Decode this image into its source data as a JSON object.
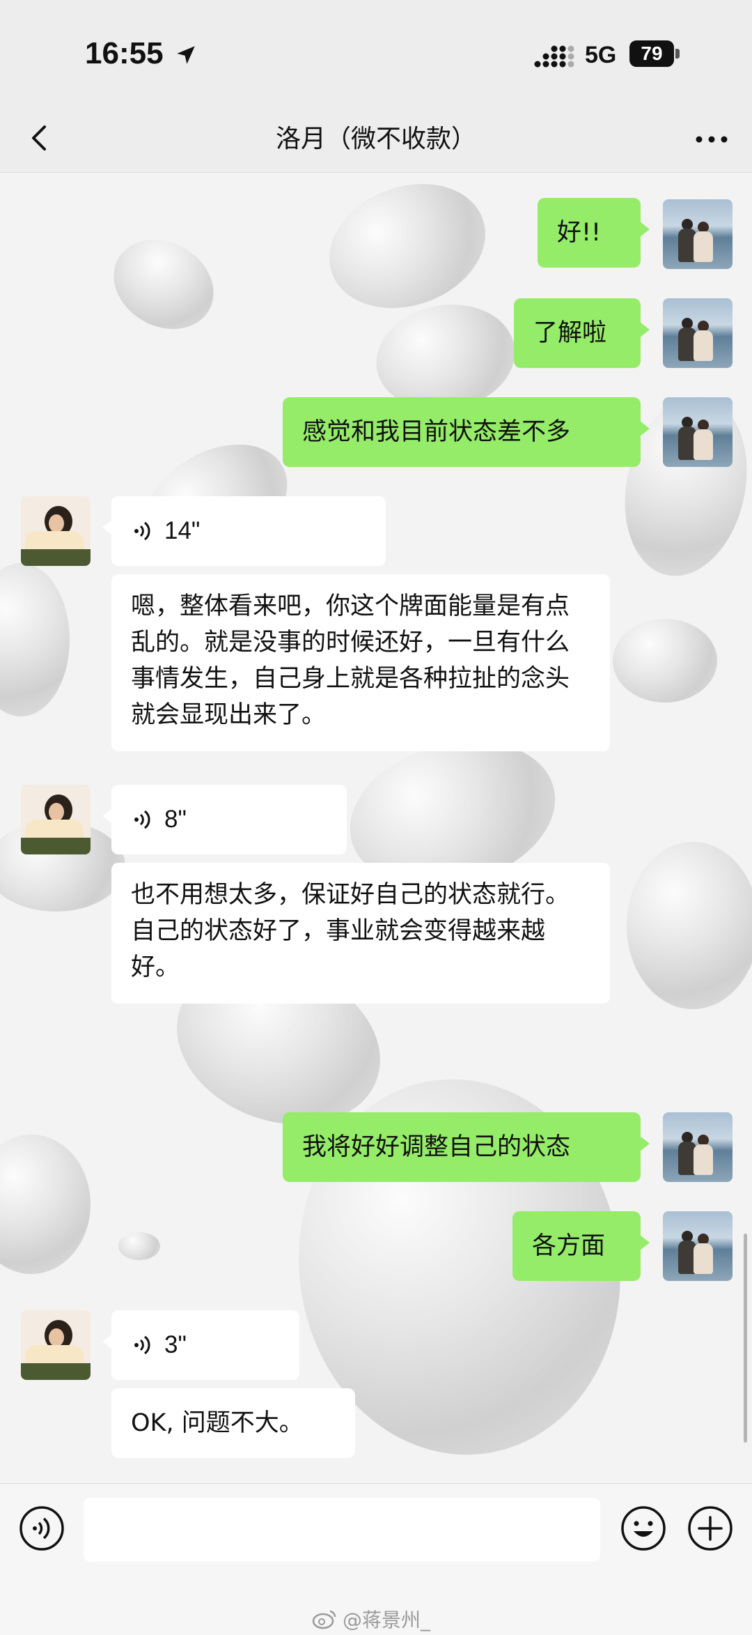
{
  "status_bar": {
    "time": "16:55",
    "network": "5G",
    "battery": "79",
    "icons": [
      "location-arrow-icon",
      "signal-icon",
      "battery-icon"
    ]
  },
  "nav": {
    "title": "洛月（微不收款）",
    "back_icon": "chevron-left-icon",
    "more_icon": "more-dots-icon"
  },
  "messages": [
    {
      "side": "out",
      "type": "text",
      "text": "好!!"
    },
    {
      "side": "out",
      "type": "text",
      "text": "了解啦"
    },
    {
      "side": "out",
      "type": "text",
      "text": "感觉和我目前状态差不多"
    },
    {
      "side": "in",
      "type": "voice",
      "duration": "14\"",
      "transcript": "嗯，整体看来吧，你这个牌面能量是有点乱的。就是没事的时候还好，一旦有什么事情发生，自己身上就是各种拉扯的念头就会显现出来了。"
    },
    {
      "side": "in",
      "type": "voice",
      "duration": "8\"",
      "transcript": "也不用想太多，保证好自己的状态就行。自己的状态好了，事业就会变得越来越好。"
    },
    {
      "side": "out",
      "type": "text",
      "text": "我将好好调整自己的状态"
    },
    {
      "side": "out",
      "type": "text",
      "text": "各方面"
    },
    {
      "side": "in",
      "type": "voice",
      "duration": "3\"",
      "transcript": "OK, 问题不大。"
    }
  ],
  "input_bar": {
    "voice_icon": "voice-mode-icon",
    "emoji_icon": "emoji-icon",
    "plus_icon": "plus-icon",
    "input_value": ""
  },
  "watermark": {
    "text": "@蒋景州_",
    "icon": "weibo-icon"
  },
  "colors": {
    "outgoing_bubble": "#95ec69",
    "incoming_bubble": "#ffffff",
    "chrome": "#ededed"
  }
}
